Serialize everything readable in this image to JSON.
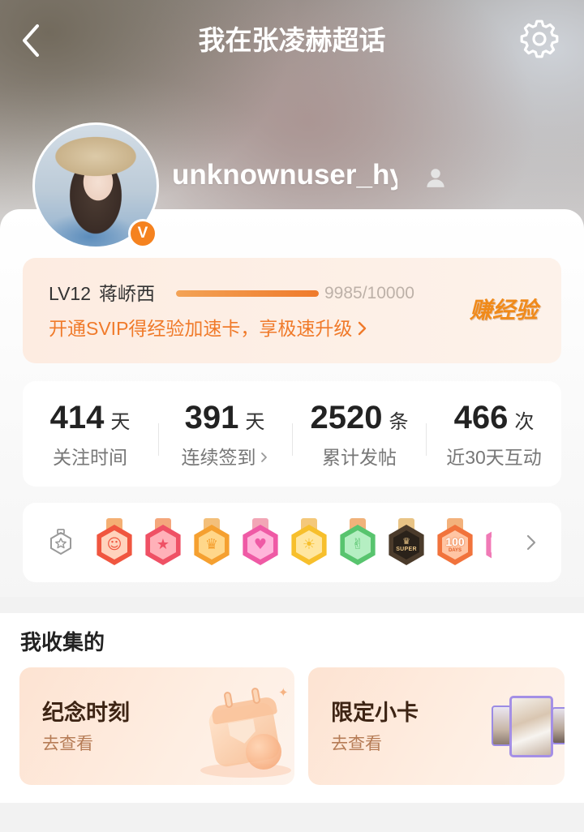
{
  "header": {
    "title": "我在张凌赫超话",
    "back_icon": "chevron-left-icon",
    "settings_icon": "gear-icon"
  },
  "profile": {
    "username": "unknownuser_hy",
    "verified_mark": "V",
    "user_icon": "person-icon"
  },
  "level": {
    "level": "LV12",
    "title": "蒋峤西",
    "progress_text": "9985/10000",
    "progress": 0.9985,
    "earn_label": "赚经验",
    "promo": "开通SVIP得经验加速卡，享极速升级"
  },
  "stats": [
    {
      "value": "414",
      "unit": "天",
      "label": "关注时间"
    },
    {
      "value": "391",
      "unit": "天",
      "label": "连续签到"
    },
    {
      "value": "2520",
      "unit": "条",
      "label": "累计发帖"
    },
    {
      "value": "466",
      "unit": "次",
      "label": "近30天互动"
    }
  ],
  "badges": {
    "wall_icon": "badge-wall-icon",
    "items": [
      {
        "icon": "cat-badge-icon",
        "color": "#f0563f",
        "inner": "#ffd3bd",
        "ribbon": "#f4b074"
      },
      {
        "icon": "trophy-badge-icon",
        "color": "#ef5165",
        "inner": "#ffb1b9",
        "ribbon": "#f4a77c"
      },
      {
        "icon": "crown-badge-icon",
        "color": "#f5a030",
        "inner": "#ffd78a",
        "ribbon": "#f3bf7a"
      },
      {
        "icon": "live-badge-icon",
        "color": "#ef5aa5",
        "inner": "#ffb5da",
        "ribbon": "#f2a6b6"
      },
      {
        "icon": "hi-badge-icon",
        "color": "#f7bf2c",
        "inner": "#ffe6a0",
        "ribbon": "#f4c87a"
      },
      {
        "icon": "hand-badge-icon",
        "color": "#58c46e",
        "inner": "#b5efc2",
        "ribbon": "#f0b27a"
      },
      {
        "icon": "super-badge-icon",
        "color": "#4b3b2b",
        "inner": "#2a221a",
        "ribbon": "#e9c486",
        "text": "SUPER"
      },
      {
        "icon": "100-days-badge-icon",
        "color": "#f1733c",
        "inner": "#ffc5a4",
        "ribbon": "#f3b27c",
        "text": "100",
        "subtext": "DAYS"
      },
      {
        "icon": "pink-badge-icon",
        "color": "#f07ab6",
        "inner": "#ffc3e0",
        "ribbon": "#f3b0c6"
      }
    ]
  },
  "collection": {
    "heading": "我收集的",
    "cards": [
      {
        "title": "纪念时刻",
        "action": "去查看",
        "illustration": "calendar-icon"
      },
      {
        "title": "限定小卡",
        "action": "去查看",
        "illustration": "photo-cards-icon"
      }
    ]
  },
  "colors": {
    "accent": "#f07a2a",
    "progress_fill": "#ef7a2b",
    "progress_track": "#f7d9c4",
    "verified": "#f5821f",
    "card_title": "#3d2414"
  }
}
